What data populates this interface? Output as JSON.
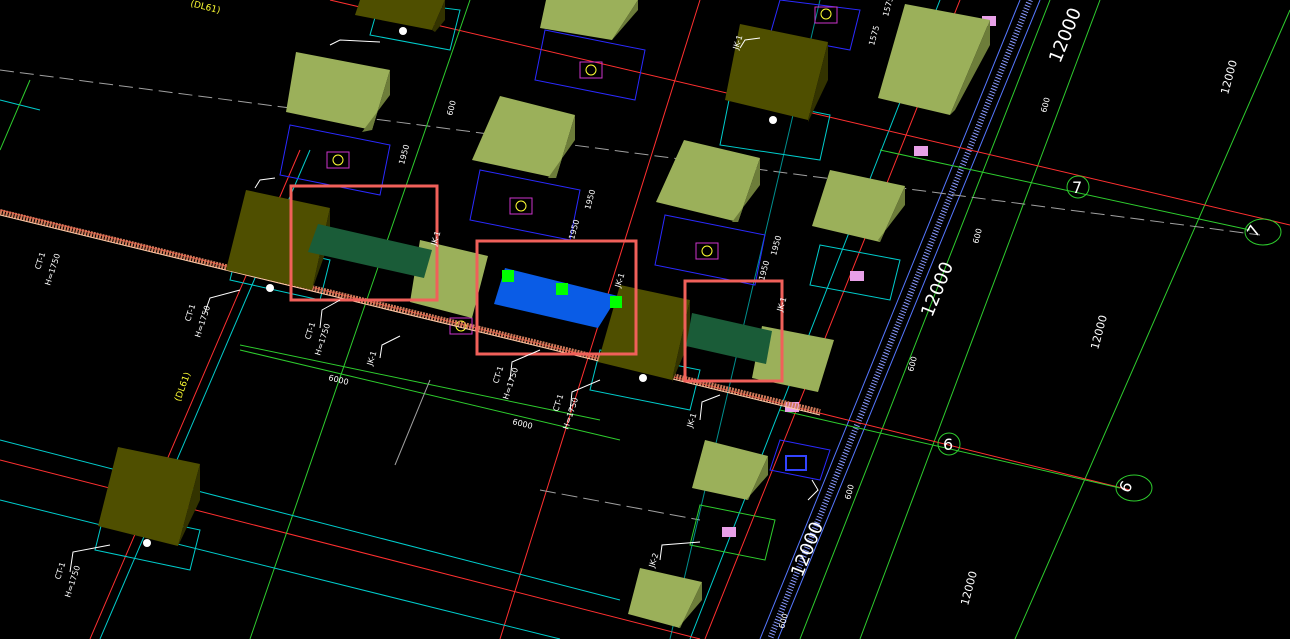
{
  "dimensions": {
    "top_right": "12000",
    "middle": "12000",
    "bottom": "12000",
    "far_right_top": "12000",
    "far_right_mid": "12000",
    "far_right_bottom": "12000",
    "span_left": "6000",
    "span_center": "6000",
    "small_labels": [
      "600",
      "600",
      "600",
      "600",
      "600",
      "600",
      "1575",
      "1575",
      "1950",
      "1950",
      "1950",
      "1950",
      "1950"
    ]
  },
  "axes": {
    "label_7a": "7",
    "label_7b": "7",
    "label_6a": "6",
    "label_6b": "6"
  },
  "annotations": {
    "dl_top": "(DL61)",
    "dl_mid": "(DL61)",
    "ct_labels": [
      "CT-1",
      "CT-1",
      "CT-1",
      "CT-1",
      "CT-1",
      "CT-1"
    ],
    "h_labels": [
      "H=1750",
      "H=1750",
      "H=1750",
      "H=1750",
      "H=1750",
      "H=1750"
    ],
    "jk_labels": [
      "JK-1",
      "JK-1",
      "JK-1",
      "JK-1",
      "JK-1",
      "JK-2",
      "JK-1"
    ]
  },
  "highlight_colors": {
    "selection_box": "#f0605a",
    "selected_beam": "#0a5ce6",
    "grip": "#00ff00",
    "beam": "#1a5c38",
    "cap_light": "#9bb05a",
    "cap_dark": "#4f4f00"
  }
}
